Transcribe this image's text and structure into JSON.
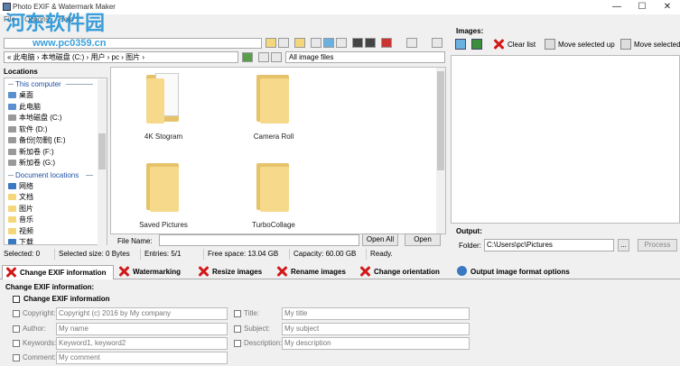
{
  "window": {
    "title": "Photo EXIF & Watermark Maker",
    "controls": {
      "minimize": "—",
      "maximize": "☐",
      "close": "✕"
    }
  },
  "watermark": {
    "site_cn": "河东软件园",
    "site_url": "www.pc0359.cn"
  },
  "menubar": {
    "items": [
      "File",
      "Options",
      "Help"
    ]
  },
  "browser": {
    "address": "« 此电脑 › 本地磁盘 (C:) › 用户 › pc › 图片 ›",
    "filter": "All image files"
  },
  "locations": {
    "header": "Locations",
    "group_this_computer": "This computer",
    "this_computer_items": [
      "桌面",
      "此电脑",
      "本地磁盘 (C:)",
      "软件 (D:)",
      "备份[勿删] (E:)",
      "新加卷 (F:)",
      "新加卷 (G:)"
    ],
    "group_documents": "Document locations",
    "document_items": [
      "网络",
      "文档",
      "图片",
      "音乐",
      "视频",
      "下载"
    ]
  },
  "files": {
    "items": [
      "4K Stogram",
      "Camera Roll",
      "Saved Pictures",
      "TurboCollage"
    ]
  },
  "filename": {
    "label": "File Name:",
    "value": "",
    "open_all": "Open All",
    "open": "Open"
  },
  "status": {
    "selected": "Selected: 0",
    "selected_size": "Selected size: 0 Bytes",
    "entries": "Entries: 5/1",
    "free_space": "Free space: 13.04 GB",
    "capacity": "Capacity: 60.00 GB",
    "ready": "Ready."
  },
  "images": {
    "label": "Images:",
    "clear_list": "Clear list",
    "move_up": "Move selected up",
    "move_down": "Move selected"
  },
  "output": {
    "label": "Output:",
    "folder_label": "Folder:",
    "folder_value": "C:\\Users\\pc\\Pictures",
    "browse": "...",
    "process": "Process"
  },
  "tabs": [
    "Change EXIF information",
    "Watermarking",
    "Resize images",
    "Rename images",
    "Change orientation",
    "Output image format options"
  ],
  "exif": {
    "group_label": "Change EXIF information:",
    "enable_label": "Change EXIF information",
    "copyright_label": "Copyright:",
    "copyright_value": "Copyright (c) 2016 by My company",
    "author_label": "Author:",
    "author_value": "My name",
    "keywords_label": "Keywords:",
    "keywords_value": "Keyword1, keyword2",
    "comment_label": "Comment:",
    "comment_value": "My comment",
    "title_label": "Title:",
    "title_value": "My title",
    "subject_label": "Subject:",
    "subject_value": "My subject",
    "description_label": "Description:",
    "description_value": "My description"
  },
  "colors": {
    "accent_blue": "#1f4fa3",
    "folder_yellow": "#f6d98a",
    "red_x": "#d21919",
    "watermark_blue": "#1a8fd6"
  }
}
